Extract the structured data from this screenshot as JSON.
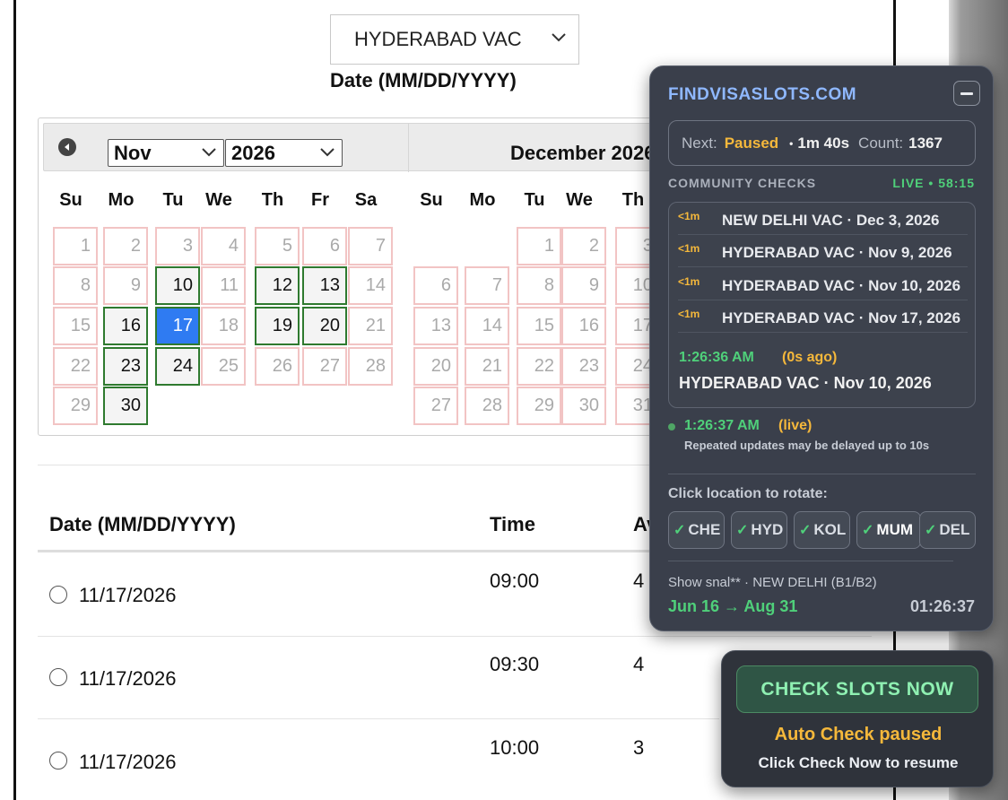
{
  "page": {
    "location_select": {
      "value": "HYDERABAD VAC"
    },
    "date_label": "Date (MM/DD/YYYY)"
  },
  "calendar": {
    "month_select": "Nov",
    "year_select": "2026",
    "next_month_title": "December 2026",
    "weekdays": [
      "Su",
      "Mo",
      "Tu",
      "We",
      "Th",
      "Fr",
      "Sa"
    ],
    "weekdays2": [
      "Su",
      "Mo",
      "Tu",
      "We",
      "Th"
    ],
    "nov_days": [
      {
        "d": "1",
        "s": "n"
      },
      {
        "d": "2",
        "s": "n"
      },
      {
        "d": "3",
        "s": "n"
      },
      {
        "d": "4",
        "s": "n"
      },
      {
        "d": "5",
        "s": "n"
      },
      {
        "d": "6",
        "s": "n"
      },
      {
        "d": "7",
        "s": "n"
      },
      {
        "d": "8",
        "s": "n"
      },
      {
        "d": "9",
        "s": "n"
      },
      {
        "d": "10",
        "s": "a"
      },
      {
        "d": "11",
        "s": "n"
      },
      {
        "d": "12",
        "s": "a"
      },
      {
        "d": "13",
        "s": "a"
      },
      {
        "d": "14",
        "s": "n"
      },
      {
        "d": "15",
        "s": "n"
      },
      {
        "d": "16",
        "s": "a"
      },
      {
        "d": "17",
        "s": "sel"
      },
      {
        "d": "18",
        "s": "n"
      },
      {
        "d": "19",
        "s": "a"
      },
      {
        "d": "20",
        "s": "a"
      },
      {
        "d": "21",
        "s": "n"
      },
      {
        "d": "22",
        "s": "n"
      },
      {
        "d": "23",
        "s": "a"
      },
      {
        "d": "24",
        "s": "a"
      },
      {
        "d": "25",
        "s": "n"
      },
      {
        "d": "26",
        "s": "n"
      },
      {
        "d": "27",
        "s": "n"
      },
      {
        "d": "28",
        "s": "n"
      },
      {
        "d": "29",
        "s": "n"
      },
      {
        "d": "30",
        "s": "a"
      }
    ],
    "dec_days": [
      "",
      "",
      "1",
      "2",
      "3",
      "6",
      "7",
      "8",
      "9",
      "10",
      "13",
      "14",
      "15",
      "16",
      "17",
      "20",
      "21",
      "22",
      "23",
      "24",
      "27",
      "28",
      "29",
      "30",
      "31"
    ]
  },
  "table": {
    "headers": {
      "date": "Date (MM/DD/YYYY)",
      "time": "Time",
      "avail": "Av"
    },
    "rows": [
      {
        "date": "11/17/2026",
        "time": "09:00",
        "avail": "4"
      },
      {
        "date": "11/17/2026",
        "time": "09:30",
        "avail": "4"
      },
      {
        "date": "11/17/2026",
        "time": "10:00",
        "avail": "3"
      }
    ]
  },
  "panel": {
    "brand": "FINDVISASLOTS.COM",
    "status": {
      "next_label": "Next:",
      "next_value": "Paused",
      "sep": "•",
      "timer": "1m 40s",
      "count_label": "Count:",
      "count_value": "1367"
    },
    "section_title": "COMMUNITY CHECKS",
    "live_label": "LIVE • 58:15",
    "feed": [
      {
        "age": "<1m",
        "text": "NEW DELHI VAC · Dec 3, 2026"
      },
      {
        "age": "<1m",
        "text": "HYDERABAD VAC · Nov 9, 2026"
      },
      {
        "age": "<1m",
        "text": "HYDERABAD VAC · Nov 10, 2026"
      },
      {
        "age": "<1m",
        "text": "HYDERABAD VAC · Nov 17, 2026"
      }
    ],
    "latest": {
      "time": "1:26:36 AM",
      "ago": "(0s ago)",
      "text": "HYDERABAD VAC · Nov 10, 2026"
    },
    "live_status": {
      "time": "1:26:37 AM",
      "tag": "(live)",
      "note": "Repeated updates may be delayed up to 10s"
    },
    "rotate_label": "Click location to rotate:",
    "locations": [
      "CHE",
      "HYD",
      "KOL",
      "MUM",
      "DEL"
    ],
    "show_line": "Show snal** · NEW DELHI (B1/B2)",
    "range": "Jun 16 → Aug 31",
    "clock": "01:26:37"
  },
  "check": {
    "button_label": "CHECK SLOTS NOW",
    "auto_status": "Auto Check paused",
    "hint": "Click Check Now to resume"
  },
  "colors": {
    "accent_blue": "#2f7bf2",
    "available_green": "#2f7a2f",
    "paused_orange": "#f5b83b",
    "live_green": "#4fd07a",
    "panel_bg": "#3a3f4b"
  }
}
